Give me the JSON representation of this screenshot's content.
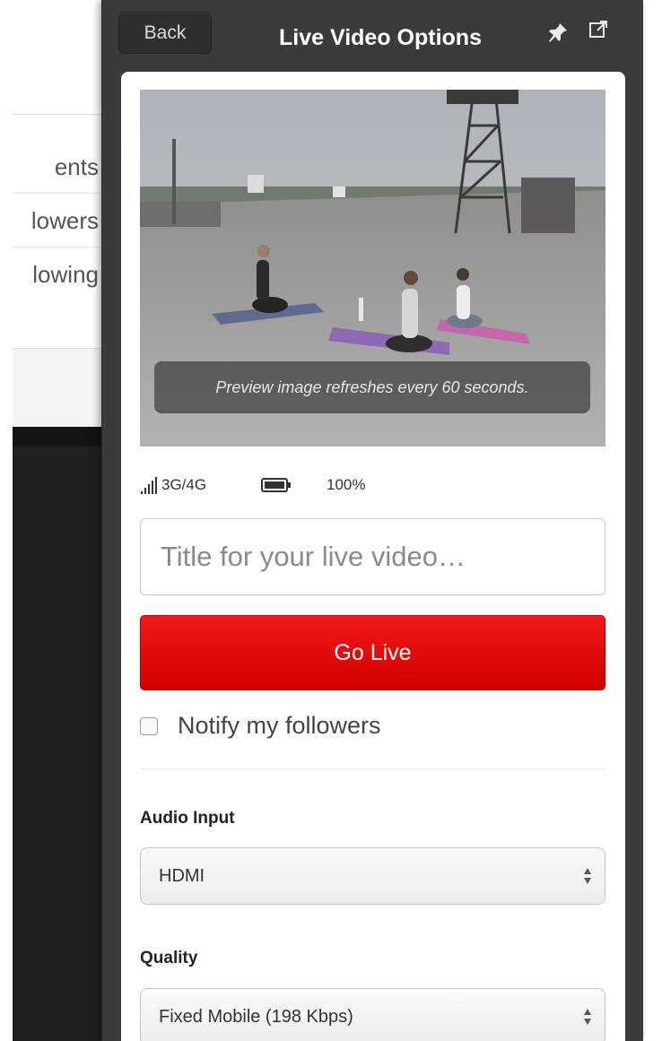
{
  "background_nav": {
    "items": [
      "ents",
      "lowers",
      "lowing"
    ]
  },
  "panel": {
    "back_label": "Back",
    "title": "Live Video Options",
    "preview": {
      "caption": "Preview image refreshes every 60 seconds."
    },
    "status": {
      "network": "3G/4G",
      "battery": "100%",
      "signal_icon": "signal-bars-icon",
      "battery_icon": "battery-icon"
    },
    "title_input": {
      "placeholder": "Title for your live video…",
      "value": ""
    },
    "go_live_label": "Go Live",
    "notify": {
      "label": "Notify my followers",
      "checked": false
    },
    "audio_input": {
      "label": "Audio Input",
      "selected": "HDMI"
    },
    "quality": {
      "label": "Quality",
      "selected": "Fixed Mobile (198 Kbps)"
    },
    "colors": {
      "panel_bg": "#3b3b3b",
      "go_live": "#e60000"
    }
  }
}
